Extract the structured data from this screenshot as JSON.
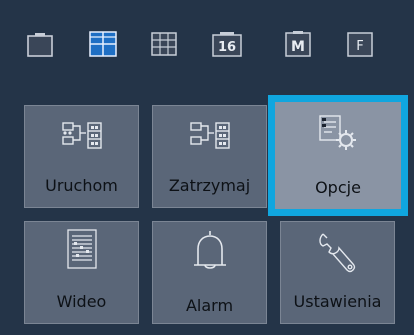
{
  "toolbar": {
    "layouts": [
      {
        "name": "layout-single-icon",
        "label": ""
      },
      {
        "name": "layout-quad-icon",
        "label": ""
      },
      {
        "name": "layout-nine-icon",
        "label": ""
      },
      {
        "name": "layout-sixteen-icon",
        "label": "16"
      },
      {
        "name": "layout-main-icon",
        "label": "M"
      },
      {
        "name": "layout-full-icon",
        "label": "F"
      }
    ],
    "active_index": 1,
    "colors": {
      "active": "#1f6fc4",
      "inactive_border": "#c8ced8"
    }
  },
  "tiles": {
    "start": {
      "label": "Uruchom",
      "icon": "record-start-icon"
    },
    "stop": {
      "label": "Zatrzymaj",
      "icon": "record-stop-icon"
    },
    "options": {
      "label": "Opcje",
      "icon": "options-icon",
      "selected": true
    },
    "video": {
      "label": "Wideo",
      "icon": "video-playback-icon"
    },
    "alarm": {
      "label": "Alarm",
      "icon": "alarm-bell-icon"
    },
    "settings": {
      "label": "Ustawienia",
      "icon": "wrench-icon"
    }
  },
  "colors": {
    "background": "#243448",
    "tile": "#5a6678",
    "selection": "#10a6df"
  }
}
